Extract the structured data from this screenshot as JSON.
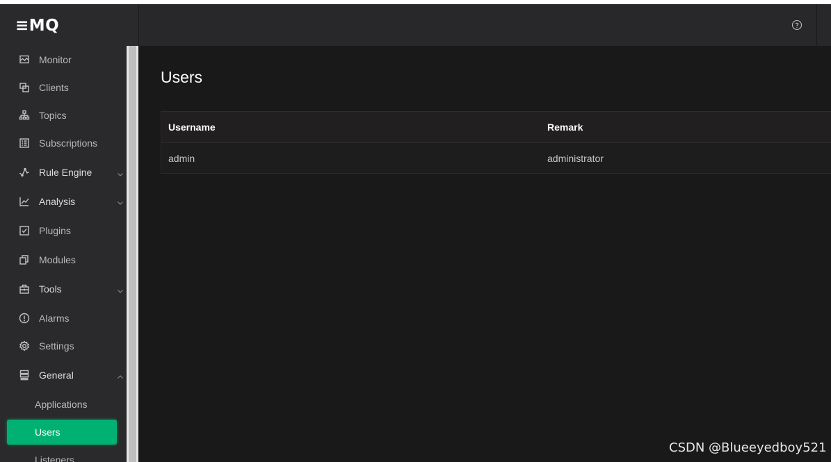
{
  "app": {
    "logo": "≡MQ"
  },
  "sidebar": {
    "items": [
      {
        "label": "Monitor",
        "icon": "monitor-icon"
      },
      {
        "label": "Clients",
        "icon": "clients-icon"
      },
      {
        "label": "Topics",
        "icon": "topics-icon"
      },
      {
        "label": "Subscriptions",
        "icon": "subscriptions-icon"
      },
      {
        "label": "Rule Engine",
        "icon": "rule-engine-icon",
        "expandable": true
      },
      {
        "label": "Analysis",
        "icon": "analysis-icon",
        "expandable": true
      },
      {
        "label": "Plugins",
        "icon": "plugins-icon"
      },
      {
        "label": "Modules",
        "icon": "modules-icon"
      },
      {
        "label": "Tools",
        "icon": "tools-icon",
        "expandable": true
      },
      {
        "label": "Alarms",
        "icon": "alarms-icon"
      },
      {
        "label": "Settings",
        "icon": "settings-icon"
      },
      {
        "label": "General",
        "icon": "general-icon",
        "expandable": true,
        "expanded": true
      }
    ],
    "general_children": [
      {
        "label": "Applications"
      },
      {
        "label": "Users",
        "active": true
      },
      {
        "label": "Listeners"
      }
    ]
  },
  "header": {
    "help_icon": "help-circle-icon"
  },
  "main": {
    "title": "Users",
    "table": {
      "columns": [
        "Username",
        "Remark"
      ],
      "rows": [
        [
          "admin",
          "administrator"
        ]
      ]
    }
  },
  "watermark": "CSDN @Blueeyedboy521",
  "colors": {
    "accent": "#00b173",
    "sidebar_bg": "#2a2a2c",
    "main_bg": "#19191a"
  }
}
